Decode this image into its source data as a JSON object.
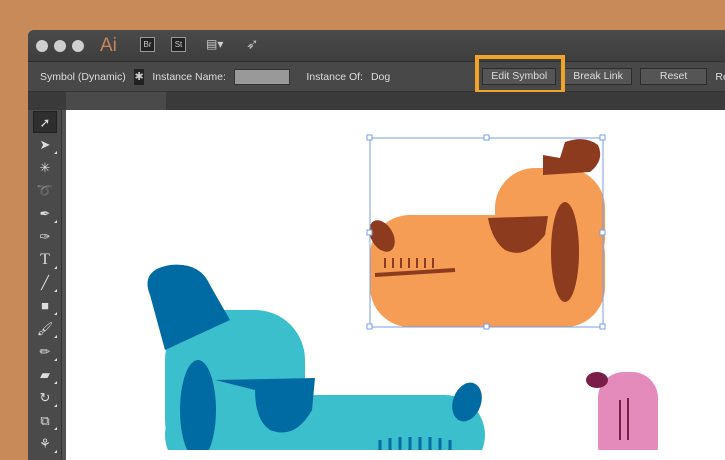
{
  "app": {
    "logo": "Ai",
    "bridge": "Br",
    "stock": "St"
  },
  "control_bar": {
    "object_type": "Symbol (Dynamic)",
    "instance_name_label": "Instance Name:",
    "instance_name_value": "",
    "instance_of_label": "Instance Of:",
    "instance_of_value": "Dog",
    "edit_symbol": "Edit Symbol",
    "break_link": "Break Link",
    "reset": "Reset",
    "replace": "Replac"
  },
  "colors": {
    "highlight": "#f2a42a",
    "orange_dog": "#f59c55",
    "teal_dog": "#3bbfcc",
    "pink_dog": "#e58bbb"
  }
}
